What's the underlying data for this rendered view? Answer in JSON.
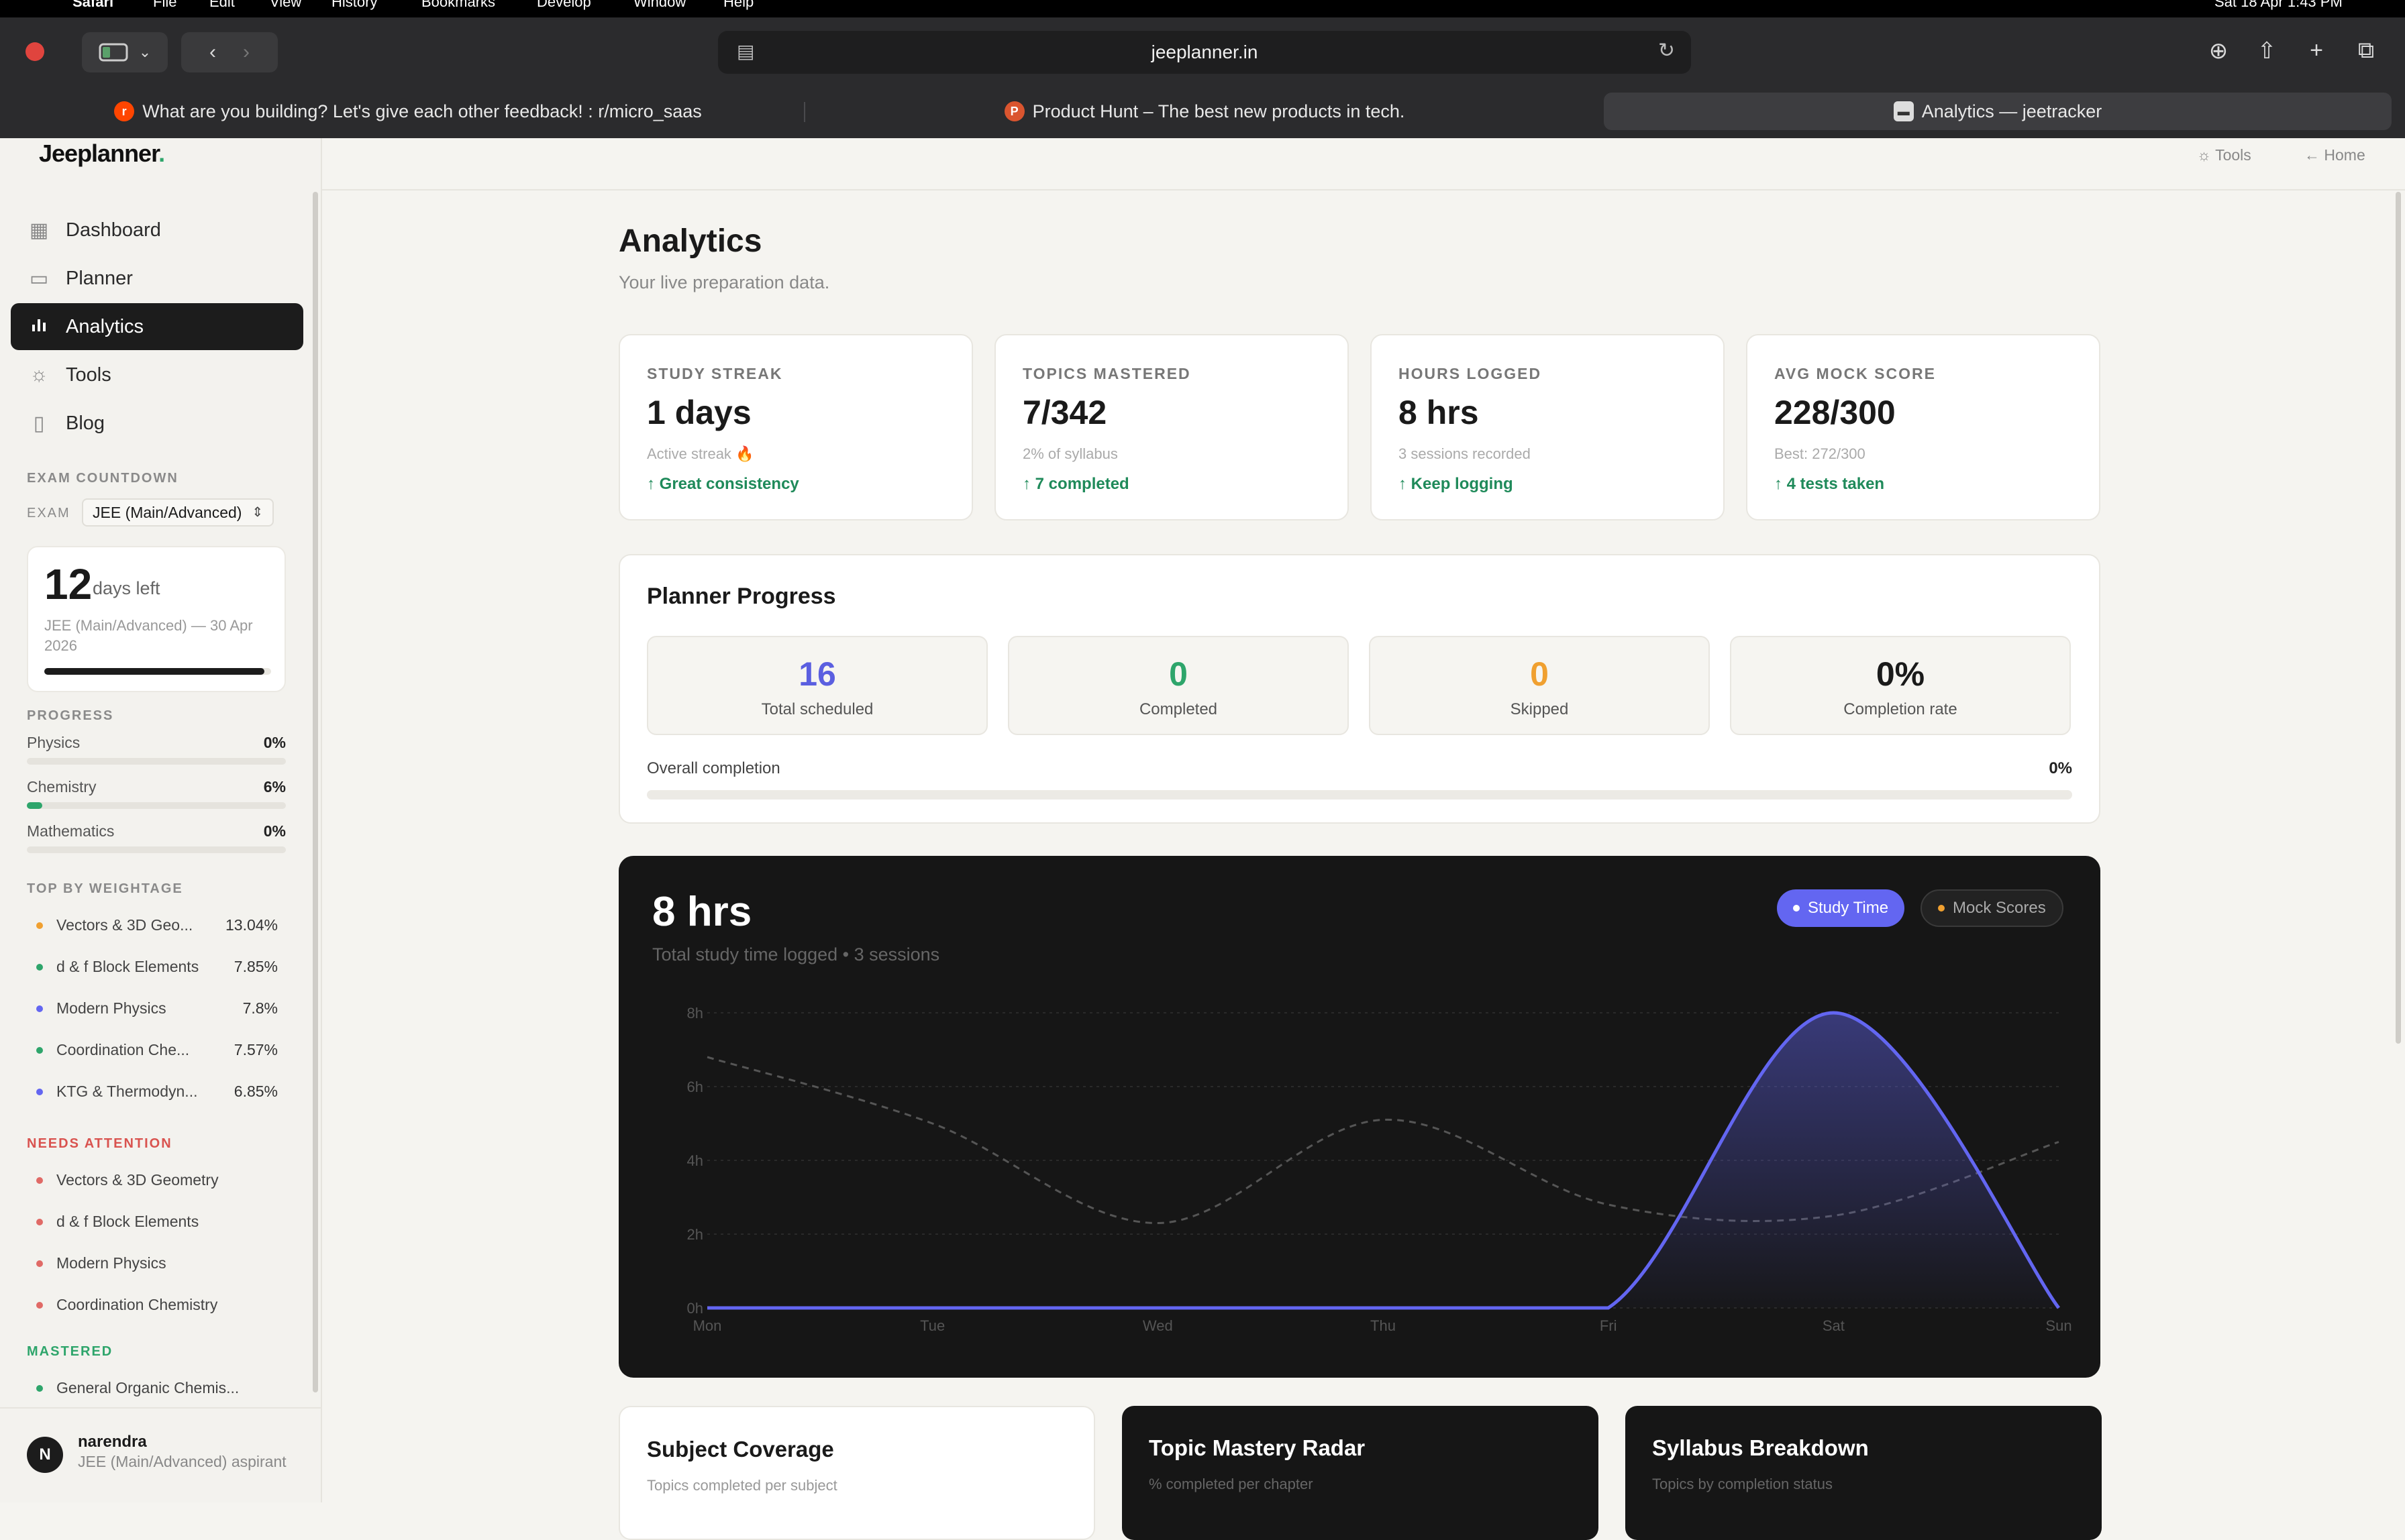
{
  "menubar": {
    "app": "Safari",
    "items": [
      "File",
      "Edit",
      "View",
      "History",
      "Bookmarks",
      "Develop",
      "Window",
      "Help"
    ],
    "clock": "Sat 18 Apr  1:43 PM"
  },
  "browser": {
    "url": "jeeplanner.in",
    "tabs": [
      {
        "title": "What are you building? Let's give each other feedback! : r/micro_saas",
        "favicon": "reddit-icon"
      },
      {
        "title": "Product Hunt – The best new products in tech.",
        "favicon": "producthunt-icon"
      },
      {
        "title": "Analytics — jeetracker",
        "favicon": "page-icon"
      }
    ]
  },
  "sidebar": {
    "logo": "Jeeplanner",
    "logo_dot": ".",
    "nav": [
      {
        "label": "Dashboard",
        "icon": "grid-icon"
      },
      {
        "label": "Planner",
        "icon": "calendar-icon"
      },
      {
        "label": "Analytics",
        "icon": "bar-chart-icon",
        "active": true
      },
      {
        "label": "Tools",
        "icon": "sun-icon"
      },
      {
        "label": "Blog",
        "icon": "book-icon"
      }
    ],
    "exam_countdown_title": "EXAM COUNTDOWN",
    "exam_label": "EXAM",
    "exam_value": "JEE (Main/Advanced)",
    "countdown": {
      "number": "12",
      "label": "days left",
      "sub": "JEE (Main/Advanced) — 30 Apr 2026",
      "progress": 0.97
    },
    "progress_title": "PROGRESS",
    "progress": [
      {
        "name": "Physics",
        "pct": "0%",
        "value": 0
      },
      {
        "name": "Chemistry",
        "pct": "6%",
        "value": 0.06
      },
      {
        "name": "Mathematics",
        "pct": "0%",
        "value": 0
      }
    ],
    "weightage_title": "TOP BY WEIGHTAGE",
    "weightage": [
      {
        "name": "Vectors & 3D Geo...",
        "value": "13.04%",
        "color": "#f0a030"
      },
      {
        "name": "d & f Block Elements",
        "value": "7.85%",
        "color": "#2ea56b"
      },
      {
        "name": "Modern Physics",
        "value": "7.8%",
        "color": "#6366f1"
      },
      {
        "name": "Coordination Che...",
        "value": "7.57%",
        "color": "#2ea56b"
      },
      {
        "name": "KTG & Thermodyn...",
        "value": "6.85%",
        "color": "#6366f1"
      }
    ],
    "attention_title": "NEEDS ATTENTION",
    "attention": [
      "Vectors & 3D Geometry",
      "d & f Block Elements",
      "Modern Physics",
      "Coordination Chemistry"
    ],
    "mastered_title": "MASTERED",
    "mastered": [
      "General Organic Chemis..."
    ],
    "user": {
      "initial": "N",
      "name": "narendra",
      "sub": "JEE (Main/Advanced) aspirant"
    }
  },
  "topbar": {
    "tools": "Tools",
    "home": "Home"
  },
  "main": {
    "title": "Analytics",
    "subtitle": "Your live preparation data.",
    "stats": [
      {
        "label": "STUDY STREAK",
        "value": "1 days",
        "sub": "Active streak 🔥",
        "trend": "↑ Great consistency"
      },
      {
        "label": "TOPICS MASTERED",
        "value": "7/342",
        "sub": "2% of syllabus",
        "trend": "↑ 7 completed"
      },
      {
        "label": "HOURS LOGGED",
        "value": "8 hrs",
        "sub": "3 sessions recorded",
        "trend": "↑ Keep logging"
      },
      {
        "label": "AVG MOCK SCORE",
        "value": "228/300",
        "sub": "Best: 272/300",
        "trend": "↑ 4 tests taken"
      }
    ],
    "planner": {
      "title": "Planner Progress",
      "boxes": [
        {
          "value": "16",
          "label": "Total scheduled",
          "color": "#5b5fe0"
        },
        {
          "value": "0",
          "label": "Completed",
          "color": "#2ea56b"
        },
        {
          "value": "0",
          "label": "Skipped",
          "color": "#f0a030"
        },
        {
          "value": "0%",
          "label": "Completion rate",
          "color": "#1a1a1a"
        }
      ],
      "overall_label": "Overall completion",
      "overall_pct": "0%",
      "overall_value": 0
    },
    "study_chart": {
      "headline": "8 hrs",
      "caption": "Total study time logged • 3 sessions",
      "toggle_on": "Study Time",
      "toggle_off": "Mock Scores",
      "accent": "#6366f1",
      "mock_dot": "#f0a030"
    },
    "bottom_cards": [
      {
        "title": "Subject Coverage",
        "sub": "Topics completed per subject"
      },
      {
        "title": "Topic Mastery Radar",
        "sub": "% completed per chapter"
      },
      {
        "title": "Syllabus Breakdown",
        "sub": "Topics by completion status"
      }
    ]
  },
  "chart_data": {
    "type": "area",
    "x": [
      "Mon",
      "Tue",
      "Wed",
      "Thu",
      "Fri",
      "Sat",
      "Sun"
    ],
    "y_ticks": [
      "0h",
      "2h",
      "4h",
      "6h",
      "8h"
    ],
    "ylim": [
      0,
      8
    ],
    "series": [
      {
        "name": "Study Time",
        "values": [
          0,
          0,
          0,
          0,
          0,
          8,
          0
        ]
      },
      {
        "values": [
          6.8,
          5,
          2.3,
          5.1,
          2.8,
          2.5,
          4.5
        ]
      }
    ],
    "grid": true
  }
}
